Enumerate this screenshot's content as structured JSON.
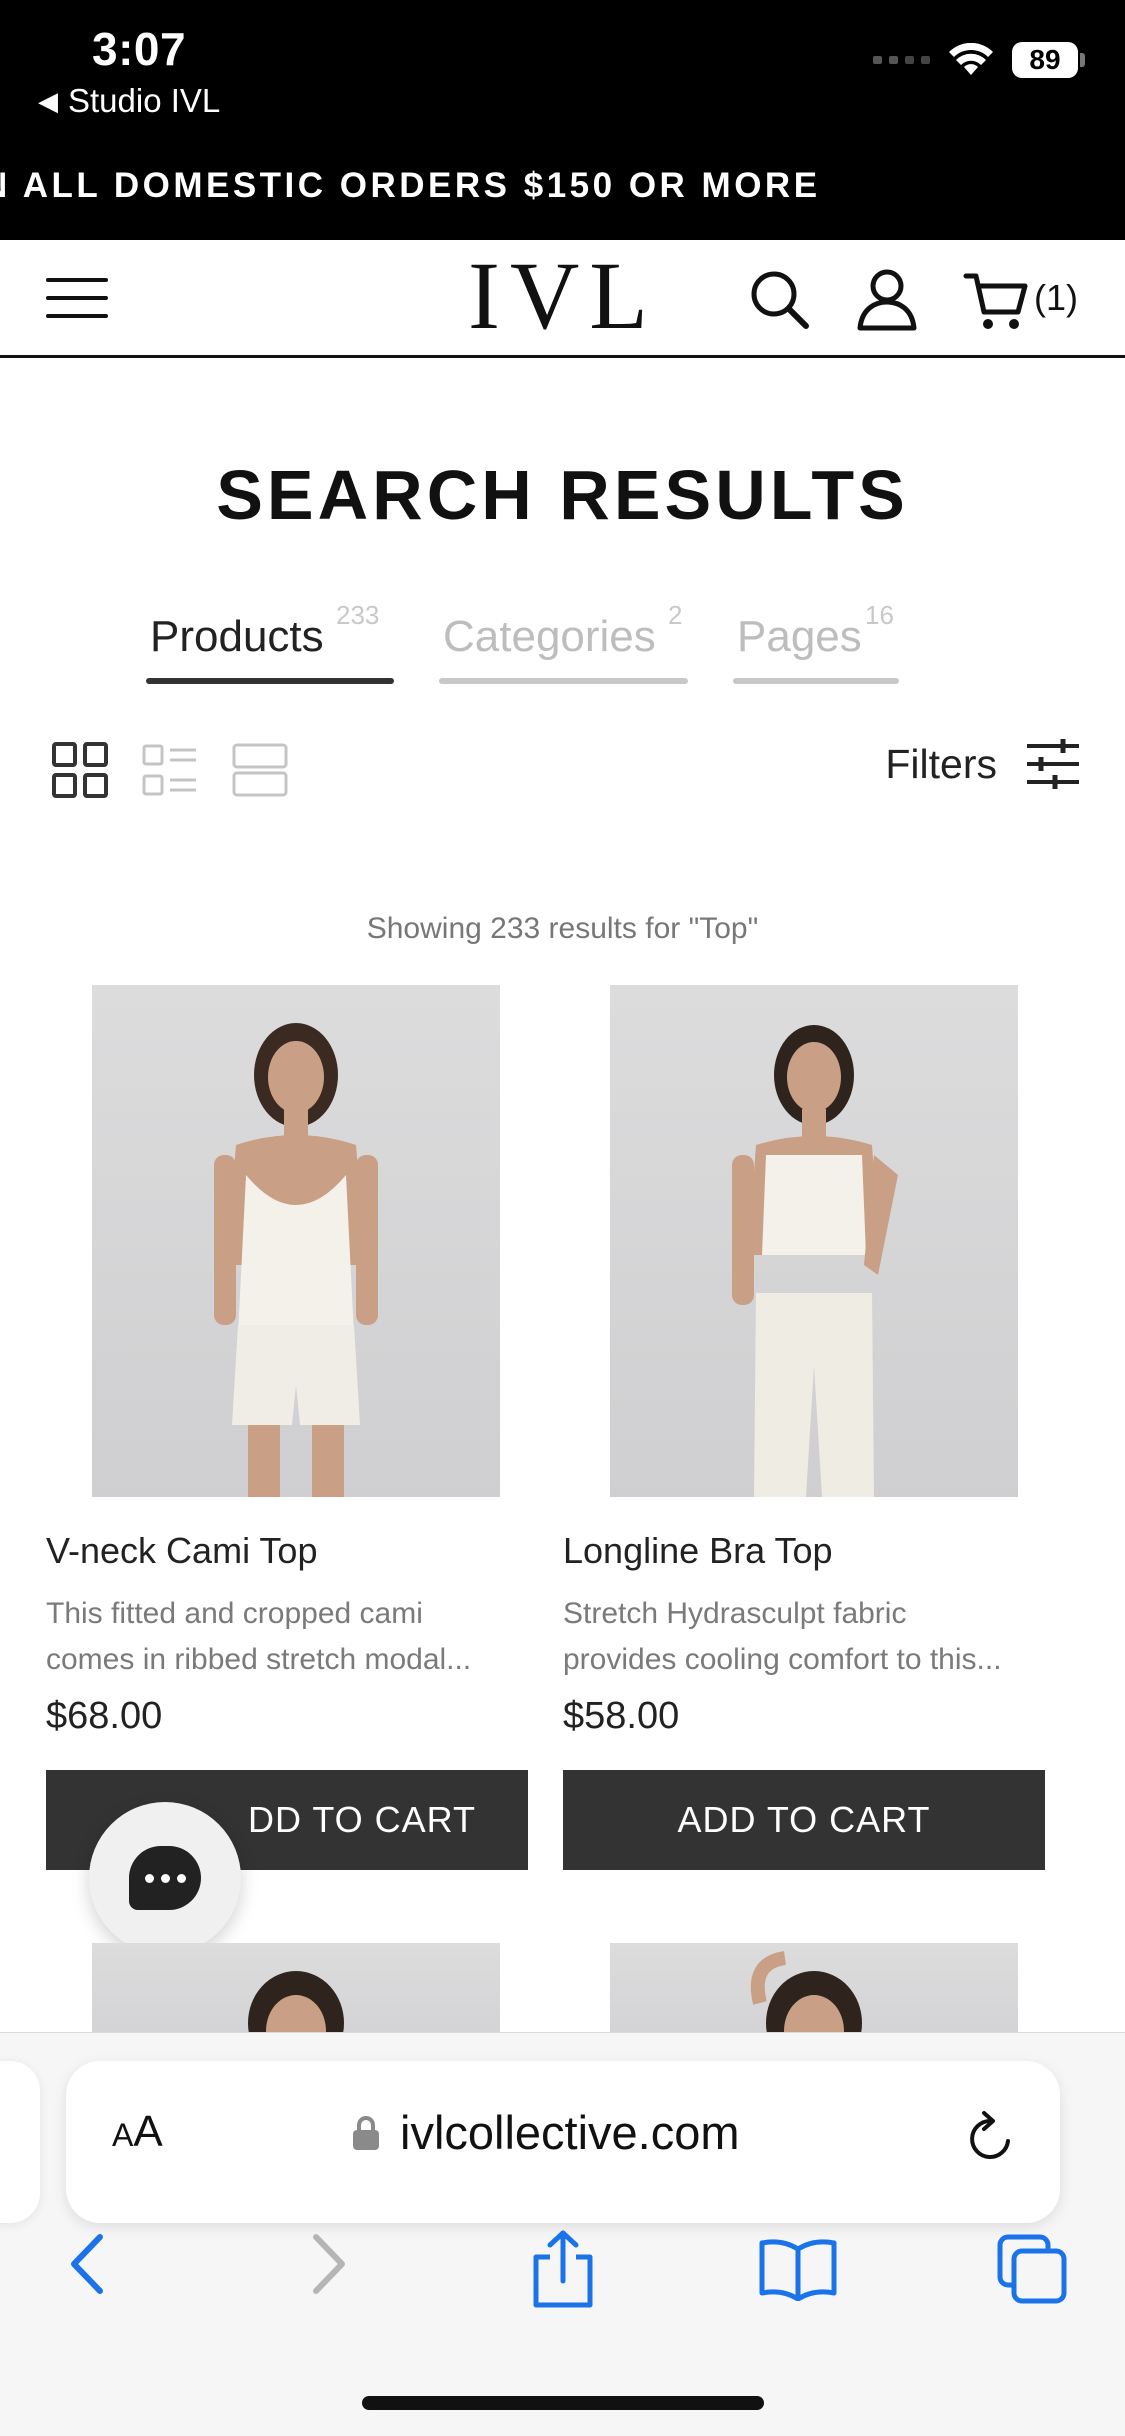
{
  "status": {
    "time": "3:07",
    "back_app": "Studio IVL",
    "battery": "89"
  },
  "promo": {
    "text": "N ALL DOMESTIC ORDERS $150 OR MORE"
  },
  "header": {
    "logo": "IVL",
    "cart_count": "(1)"
  },
  "page": {
    "title": "SEARCH RESULTS",
    "tabs": [
      {
        "label": "Products",
        "count": "233",
        "active": true
      },
      {
        "label": "Categories",
        "count": "2",
        "active": false
      },
      {
        "label": "Pages",
        "count": "16",
        "active": false
      }
    ],
    "filters_label": "Filters",
    "results_note": "Showing 233 results for \"Top\""
  },
  "products": [
    {
      "name": "V-neck Cami Top",
      "desc_line1": "This fitted and cropped cami",
      "desc_line2": "comes in ribbed stretch modal...",
      "price": "$68.00",
      "button": "DD TO CART"
    },
    {
      "name": "Longline Bra Top",
      "desc_line1": "Stretch Hydrasculpt fabric",
      "desc_line2": "provides cooling comfort to this...",
      "price": "$58.00",
      "button": "ADD TO CART"
    }
  ],
  "browser": {
    "aa_label": "AA",
    "url": "ivlcollective.com"
  },
  "colors": {
    "button_bg": "#333333",
    "safari_blue": "#1a73e8",
    "tab_active": "#333333",
    "tab_inactive": "#c8c8c8"
  }
}
